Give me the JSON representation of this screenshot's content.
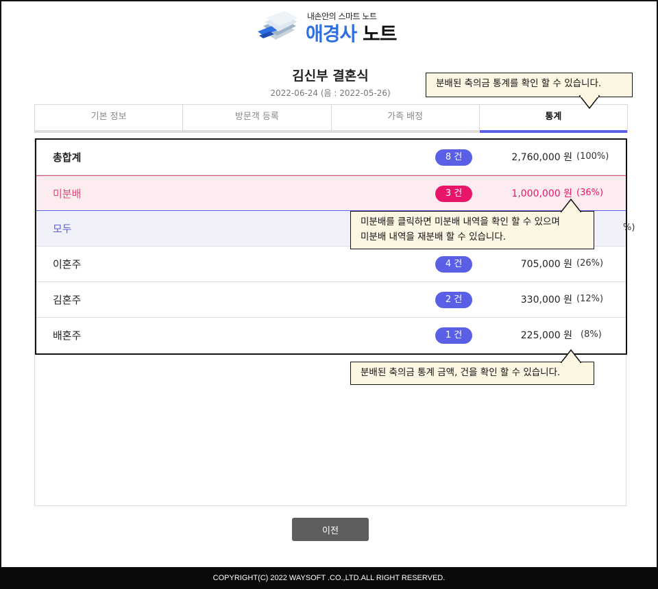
{
  "header": {
    "logo_subtitle": "내손안의 스마트 노트",
    "logo_title_part1": "애경사",
    "logo_title_part2": "노트"
  },
  "event": {
    "title": "김신부 결혼식",
    "date": "2022-06-24 (음 : 2022-05-26)"
  },
  "tabs": [
    {
      "label": "기본 정보",
      "active": false
    },
    {
      "label": "방문객 등록",
      "active": false
    },
    {
      "label": "가족 배정",
      "active": false
    },
    {
      "label": "통계",
      "active": true
    }
  ],
  "stats": {
    "rows": [
      {
        "label": "총합계",
        "count": "8 건",
        "amount": "2,760,000 원",
        "pct": "(100%)"
      },
      {
        "label": "미분배",
        "count": "3 건",
        "amount": "1,000,000 원",
        "pct": "(36%)"
      },
      {
        "label": "모두",
        "count": "",
        "amount": "",
        "pct": "%)"
      },
      {
        "label": "이혼주",
        "count": "4 건",
        "amount": "705,000 원",
        "pct": "(26%)"
      },
      {
        "label": "김혼주",
        "count": "2 건",
        "amount": "330,000 원",
        "pct": "(12%)"
      },
      {
        "label": "배혼주",
        "count": "1 건",
        "amount": "225,000 원",
        "pct": "(8%)"
      }
    ]
  },
  "tooltips": {
    "tab_stats": "분배된 축의금 통계를 확인 할 수 있습니다.",
    "unassigned_line1": "미분배를 클릭하면 미분배 내역을 확인 할 수 있으며",
    "unassigned_line2": "미분배 내역을 재분배 할 수 있습니다.",
    "amounts": "분배된 축의금 통계 금액, 건을 확인 할 수 있습니다."
  },
  "buttons": {
    "prev": "이전"
  },
  "footer": {
    "copyright": "COPYRIGHT(C) 2022 WAYSOFT .CO.,LTD.ALL RIGHT RESERVED."
  },
  "colors": {
    "accent": "#5a5fe6",
    "unassigned": "#e8166b",
    "tooltip_bg": "#fdf6e3"
  }
}
